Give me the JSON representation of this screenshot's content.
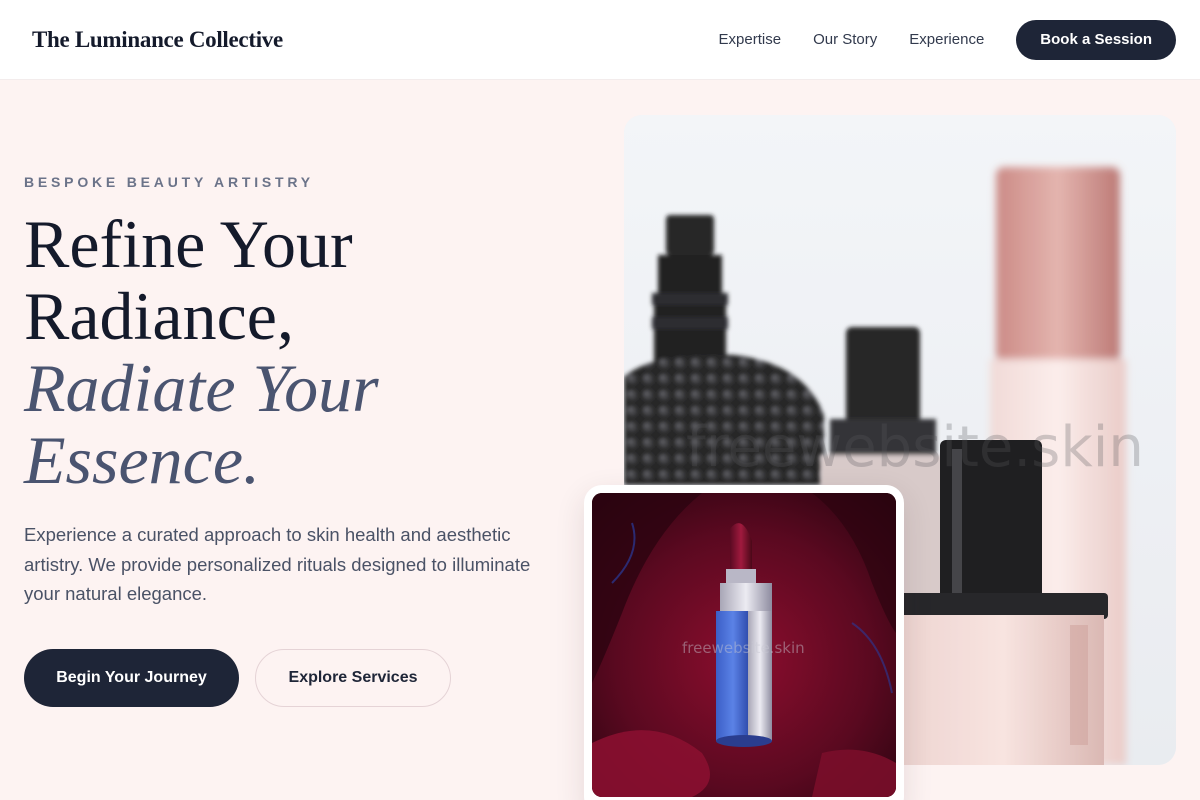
{
  "header": {
    "brand": "The Luminance Collective",
    "nav": [
      "Expertise",
      "Our Story",
      "Experience"
    ],
    "cta": "Book a Session"
  },
  "hero": {
    "eyebrow": "BESPOKE BEAUTY ARTISTRY",
    "headline_lines": [
      "Refine Your",
      "Radiance,"
    ],
    "headline_italic_lines": [
      "Radiate Your",
      "Essence."
    ],
    "description": "Experience a curated approach to skin health and aesthetic artistry. We provide personalized rituals designed to illuminate your natural elegance.",
    "primary_button": "Begin Your Journey",
    "secondary_button": "Explore Services"
  },
  "images": {
    "main_watermark": "freewebsite.skin",
    "card_watermark": "freewebsite.skin"
  },
  "colors": {
    "background": "#fdf3f2",
    "dark_navy": "#1e2537",
    "italic_slate": "#4a5470",
    "eyebrow_gray": "#6b7389"
  }
}
